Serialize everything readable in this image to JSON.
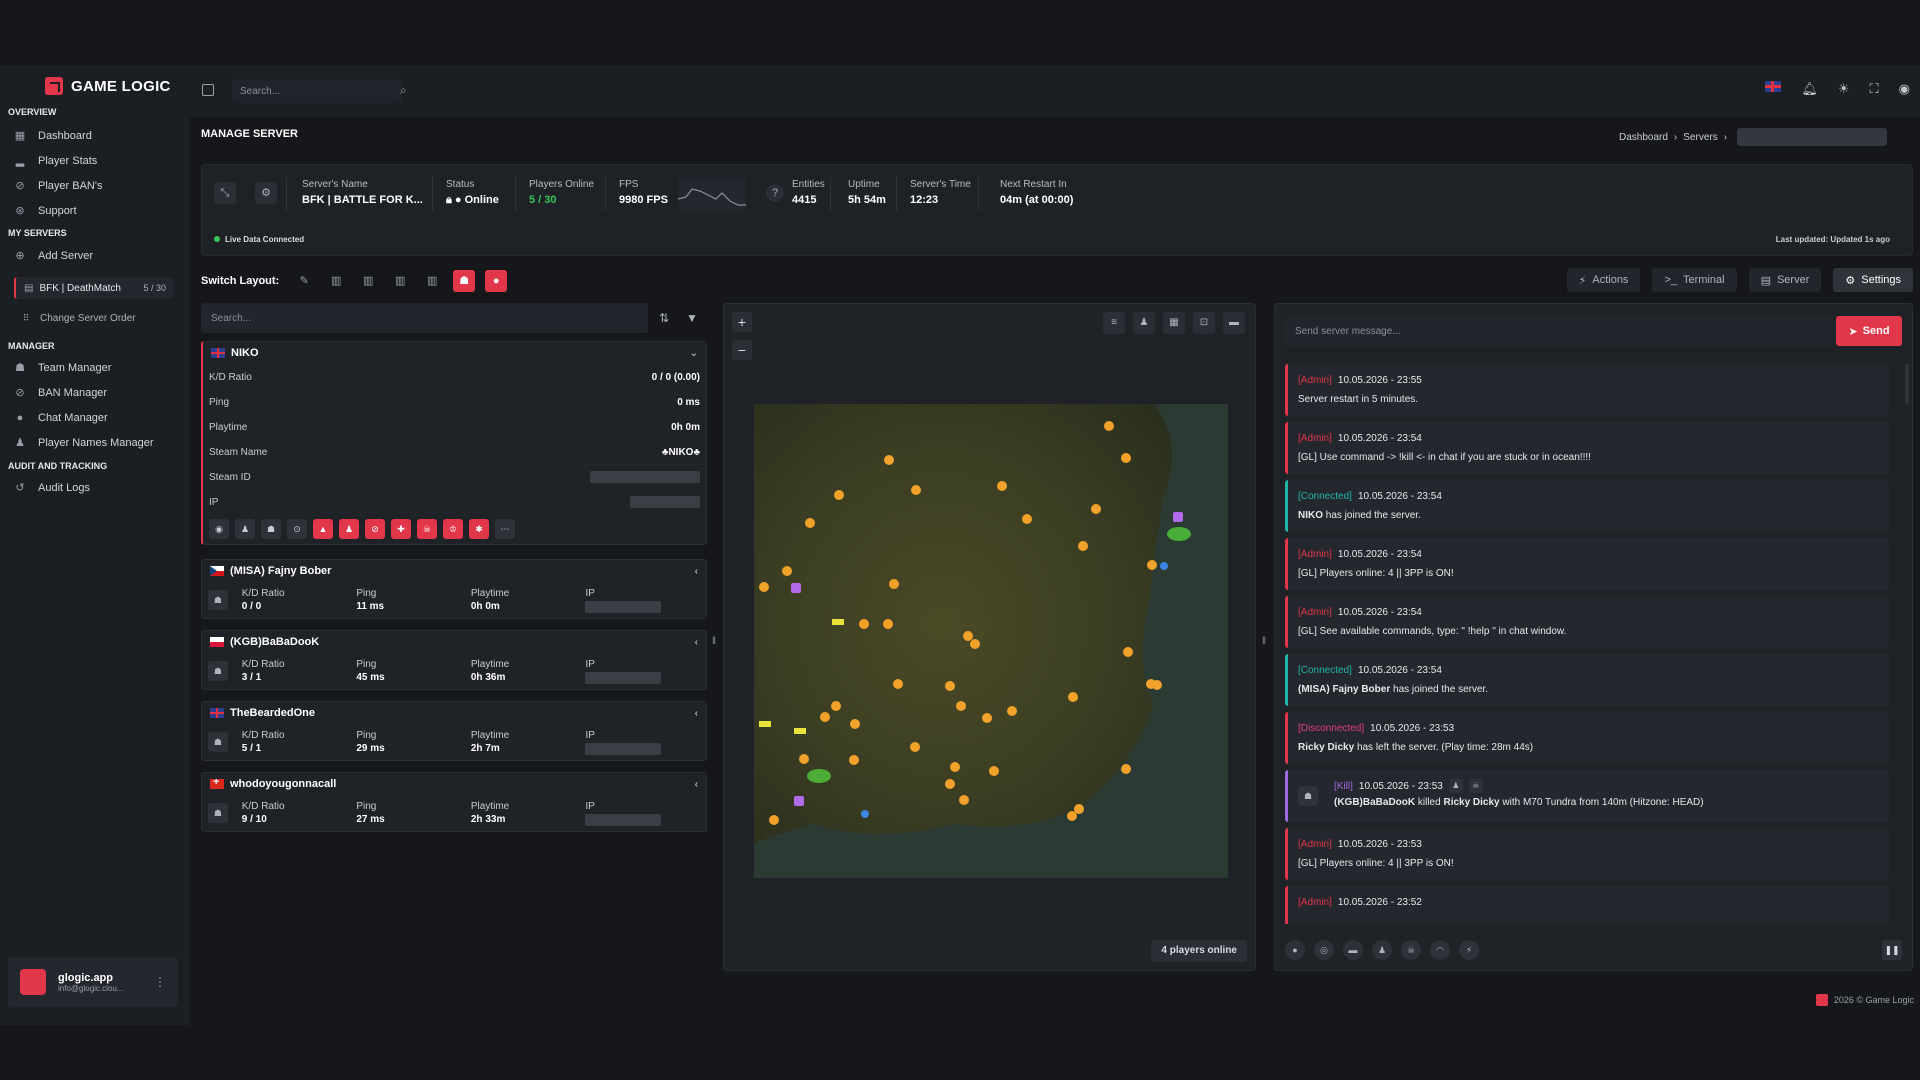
{
  "app": {
    "name": "GAME LOGIC"
  },
  "sidebar": {
    "sections": [
      {
        "title": "OVERVIEW"
      },
      {
        "title": "MY SERVERS"
      },
      {
        "title": "MANAGER"
      },
      {
        "title": "AUDIT AND TRACKING"
      }
    ],
    "overview": [
      {
        "label": "Dashboard",
        "icon": "dashboard-icon"
      },
      {
        "label": "Player Stats",
        "icon": "chart-icon"
      },
      {
        "label": "Player BAN's",
        "icon": "ban-icon"
      },
      {
        "label": "Support",
        "icon": "support-icon"
      }
    ],
    "add_server": "Add Server",
    "server_item": {
      "name": "BFK | DeathMatch",
      "count": "5 / 30"
    },
    "change_order": "Change Server Order",
    "manager": [
      {
        "label": "Team Manager",
        "icon": "team-icon"
      },
      {
        "label": "BAN Manager",
        "icon": "ban-icon"
      },
      {
        "label": "Chat Manager",
        "icon": "chat-icon"
      },
      {
        "label": "Player Names Manager",
        "icon": "user-icon"
      }
    ],
    "audit": [
      {
        "label": "Audit Logs",
        "icon": "history-icon"
      }
    ],
    "user": {
      "name": "glogic.app",
      "email": "info@glogic.clou..."
    }
  },
  "header": {
    "search_placeholder": "Search..."
  },
  "page": {
    "title": "MANAGE SERVER",
    "breadcrumb": [
      "Dashboard",
      "Servers"
    ]
  },
  "stats": {
    "server_name_label": "Server's Name",
    "server_name": "BFK | BATTLE FOR K...",
    "status_label": "Status",
    "status": "Online",
    "players_label": "Players Online",
    "players": "5 / 30",
    "fps_label": "FPS",
    "fps": "9980 FPS",
    "entities_label": "Entities",
    "entities": "4415",
    "uptime_label": "Uptime",
    "uptime": "5h 54m",
    "time_label": "Server's Time",
    "time": "12:23",
    "restart_label": "Next Restart In",
    "restart": "04m (at 00:00)",
    "live": "Live Data Connected",
    "updated": "Last updated: Updated 1s ago",
    "colors": {
      "online": "#35c759",
      "accent": "#e2364a"
    }
  },
  "layout": {
    "label": "Switch Layout:"
  },
  "actions": {
    "actions": "Actions",
    "terminal": "Terminal",
    "server": "Server",
    "settings": "Settings"
  },
  "players": {
    "search_placeholder": "Search...",
    "expanded": {
      "name": "NIKO",
      "rows": [
        {
          "label": "K/D Ratio",
          "value": "0 / 0 (0.00)"
        },
        {
          "label": "Ping",
          "value": "0 ms"
        },
        {
          "label": "Playtime",
          "value": "0h 0m"
        },
        {
          "label": "Steam Name",
          "value": "♣NIKO♣"
        },
        {
          "label": "Steam ID",
          "value": ""
        },
        {
          "label": "IP",
          "value": ""
        }
      ]
    },
    "list": [
      {
        "name": "(MISA) Fajny Bober",
        "flag": "cz",
        "kd": "0 / 0",
        "ping": "11 ms",
        "playtime": "0h 0m"
      },
      {
        "name": "(KGB)BaBaDooK",
        "flag": "pl",
        "kd": "3 / 1",
        "ping": "45 ms",
        "playtime": "0h 36m"
      },
      {
        "name": "TheBeardedOne",
        "flag": "gb",
        "kd": "5 / 1",
        "ping": "29 ms",
        "playtime": "2h 7m"
      },
      {
        "name": "whodoyougonnacall",
        "flag": "ch",
        "kd": "9 / 10",
        "ping": "27 ms",
        "playtime": "2h 33m"
      }
    ],
    "col_labels": {
      "kd": "K/D Ratio",
      "ping": "Ping",
      "playtime": "Playtime",
      "ip": "IP"
    }
  },
  "map": {
    "players_online": "4 players online"
  },
  "chat": {
    "placeholder": "Send server message...",
    "send": "Send",
    "entries": [
      {
        "type": "admin",
        "tag": "[Admin]",
        "time": "10.05.2026 - 23:55",
        "text": "Server restart in 5 minutes."
      },
      {
        "type": "admin",
        "tag": "[Admin]",
        "time": "10.05.2026 - 23:54",
        "text": "[GL] Use command -> !kill <- in chat if you are stuck or in ocean!!!!"
      },
      {
        "type": "conn",
        "tag": "[Connected]",
        "time": "10.05.2026 - 23:54",
        "who": "NIKO",
        "text": "has joined the server."
      },
      {
        "type": "admin",
        "tag": "[Admin]",
        "time": "10.05.2026 - 23:54",
        "text": "[GL] Players online: 4 || 3PP is ON!"
      },
      {
        "type": "admin",
        "tag": "[Admin]",
        "time": "10.05.2026 - 23:54",
        "text": "[GL] See available commands, type: \" !help \" in chat window."
      },
      {
        "type": "conn",
        "tag": "[Connected]",
        "time": "10.05.2026 - 23:54",
        "who": "(MISA) Fajny Bober",
        "text": "has joined the server."
      },
      {
        "type": "disc",
        "tag": "[Disconnected]",
        "time": "10.05.2026 - 23:53",
        "who": "Ricky Dicky",
        "text": "has left the server. (Play time: 28m 44s)"
      },
      {
        "type": "kill",
        "tag": "[Kill]",
        "time": "10.05.2026 - 23:53",
        "killer": "(KGB)BaBaDooK",
        "mid": "killed",
        "victim": "Ricky Dicky",
        "text": "with M70 Tundra from 140m (Hitzone: HEAD)"
      },
      {
        "type": "admin",
        "tag": "[Admin]",
        "time": "10.05.2026 - 23:53",
        "text": "[GL] Players online: 4 || 3PP is ON!"
      },
      {
        "type": "admin",
        "tag": "[Admin]",
        "time": "10.05.2026 - 23:52",
        "text": ""
      }
    ]
  },
  "footer": {
    "copyright": "2026 © Game Logic"
  }
}
